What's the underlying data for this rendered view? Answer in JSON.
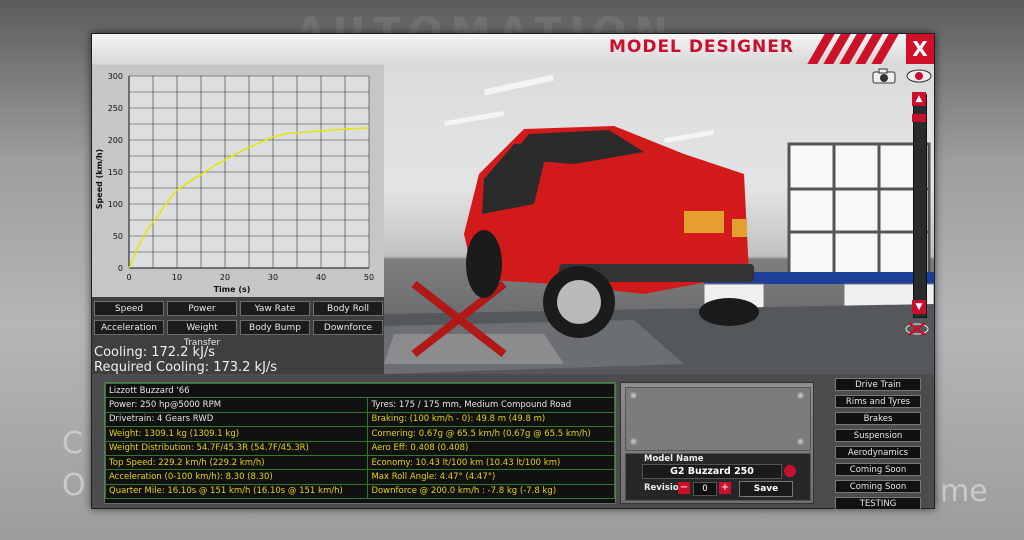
{
  "background": {
    "logo_text": "AUTOMATION",
    "left_letter_top": "C",
    "left_letter_bottom": "O",
    "right_text": "me"
  },
  "window": {
    "title": "MODEL DESIGNER",
    "close_label": "X"
  },
  "graph_buttons": [
    "Speed",
    "Power",
    "Yaw Rate",
    "Body Roll",
    "Acceleration",
    "Weight Transfer",
    "Body Bump",
    "Downforce"
  ],
  "chart_data": {
    "type": "line",
    "xlabel": "Time (s)",
    "ylabel": "Speed (km/h)",
    "xlim": [
      0,
      50
    ],
    "ylim": [
      0,
      300
    ],
    "x_ticks": [
      0,
      10,
      20,
      30,
      40,
      50
    ],
    "y_ticks": [
      0,
      50,
      100,
      150,
      200,
      250,
      300
    ],
    "grid": true,
    "series": [
      {
        "color": "#e6e600",
        "x": [
          0,
          2,
          4,
          6,
          8,
          10,
          12,
          15,
          18,
          21,
          24,
          27,
          30,
          33,
          36,
          40,
          45,
          50
        ],
        "y": [
          0,
          35,
          62,
          82,
          103,
          122,
          132,
          146,
          161,
          173,
          185,
          195,
          205,
          210,
          212,
          214,
          217,
          219
        ]
      }
    ]
  },
  "cooling": {
    "cooling": "Cooling: 172.2 kJ/s",
    "required": "Required Cooling: 173.2 kJ/s"
  },
  "stats": {
    "title": "Lizzott Buzzard '66",
    "rows": [
      {
        "left": "Power: 250 hp@5000 RPM",
        "left_hl": false,
        "right": "Tyres: 175 / 175 mm, Medium Compound Road",
        "right_hl": false
      },
      {
        "left": "Drivetrain: 4 Gears RWD",
        "left_hl": false,
        "right": "Braking: (100 km/h - 0): 49.8 m (49.8 m)",
        "right_hl": true
      },
      {
        "left": "Weight: 1309.1 kg (1309.1 kg)",
        "left_hl": true,
        "right": "Cornering: 0.67g @ 65.5 km/h (0.67g @ 65.5 km/h)",
        "right_hl": true
      },
      {
        "left": "Weight Distribution: 54.7F/45.3R (54.7F/45.3R)",
        "left_hl": true,
        "right": "Aero Eff: 0.408 (0.408)",
        "right_hl": true
      },
      {
        "left": "Top Speed: 229.2 km/h (229.2 km/h)",
        "left_hl": true,
        "right": "Economy: 10.43 lt/100 km (10.43 lt/100 km)",
        "right_hl": true
      },
      {
        "left": "Acceleration (0-100 km/h): 8.30 (8.30)",
        "left_hl": true,
        "right": "Max Roll Angle: 4.47° (4.47°)",
        "right_hl": true
      },
      {
        "left": "Quarter Mile: 16.10s @ 151 km/h (16.10s @ 151 km/h)",
        "left_hl": true,
        "right": "Downforce @ 200.0 km/h : -7.8 kg (-7.8 kg)",
        "right_hl": true
      }
    ]
  },
  "model": {
    "label": "Model Name",
    "name": "G2 Buzzard 250",
    "revision_label": "Revision",
    "revision_value": "0",
    "minus": "−",
    "plus": "+",
    "save_label": "Save"
  },
  "sidebar": [
    "Drive Train",
    "Rims and Tyres",
    "Brakes",
    "Suspension",
    "Aerodynamics",
    "Coming Soon",
    "Coming Soon",
    "TESTING"
  ],
  "colors": {
    "accent": "#c8102e",
    "stat_highlight": "#e2d40a",
    "grid_line": "#2d7a2d",
    "car_body": "#d21a1a"
  }
}
